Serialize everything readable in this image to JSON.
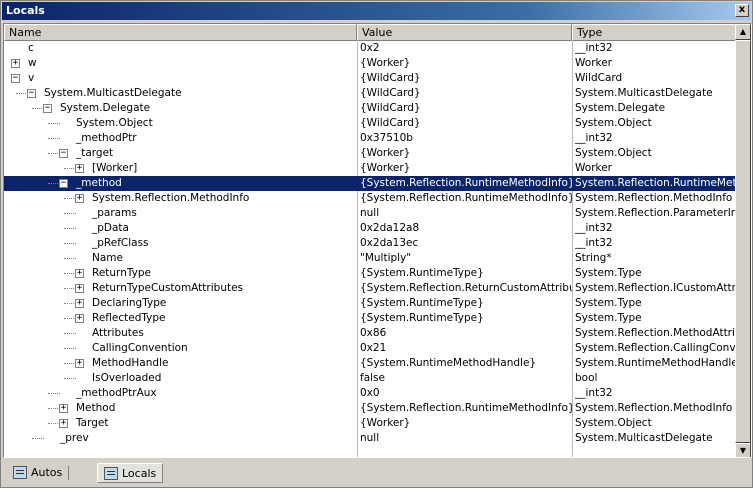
{
  "window": {
    "title": "Locals",
    "close_glyph": "x"
  },
  "columns": {
    "name": "Name",
    "value": "Value",
    "type": "Type"
  },
  "rows": [
    {
      "depth": 0,
      "toggle": "",
      "name": "c",
      "value": "0x2",
      "type": "__int32"
    },
    {
      "depth": 0,
      "toggle": "+",
      "name": "w",
      "value": "{Worker}",
      "type": "Worker"
    },
    {
      "depth": 0,
      "toggle": "-",
      "name": "v",
      "value": "{WildCard}",
      "type": "WildCard"
    },
    {
      "depth": 1,
      "toggle": "-",
      "name": "System.MulticastDelegate",
      "value": "{WildCard}",
      "type": "System.MulticastDelegate"
    },
    {
      "depth": 2,
      "toggle": "-",
      "name": "System.Delegate",
      "value": "{WildCard}",
      "type": "System.Delegate"
    },
    {
      "depth": 3,
      "toggle": "",
      "name": "System.Object",
      "value": "{WildCard}",
      "type": "System.Object"
    },
    {
      "depth": 3,
      "toggle": "",
      "name": "_methodPtr",
      "value": "0x37510b",
      "type": "__int32"
    },
    {
      "depth": 3,
      "toggle": "-",
      "name": "_target",
      "value": "{Worker}",
      "type": "System.Object"
    },
    {
      "depth": 4,
      "toggle": "+",
      "name": "[Worker]",
      "value": "{Worker}",
      "type": "Worker"
    },
    {
      "depth": 3,
      "toggle": "-",
      "name": "_method",
      "value": "{System.Reflection.RuntimeMethodInfo}",
      "type": "System.Reflection.RuntimeMetho",
      "selected": true
    },
    {
      "depth": 4,
      "toggle": "+",
      "name": "System.Reflection.MethodInfo",
      "value": "{System.Reflection.RuntimeMethodInfo}",
      "type": "System.Reflection.MethodInfo"
    },
    {
      "depth": 4,
      "toggle": "",
      "name": "_params",
      "value": "null",
      "type": "System.Reflection.ParameterInfo"
    },
    {
      "depth": 4,
      "toggle": "",
      "name": "_pData",
      "value": "0x2da12a8",
      "type": "__int32"
    },
    {
      "depth": 4,
      "toggle": "",
      "name": "_pRefClass",
      "value": "0x2da13ec",
      "type": "__int32"
    },
    {
      "depth": 4,
      "toggle": "",
      "name": "Name",
      "value": "\"Multiply\"",
      "type": "String*"
    },
    {
      "depth": 4,
      "toggle": "+",
      "name": "ReturnType",
      "value": "{System.RuntimeType}",
      "type": "System.Type"
    },
    {
      "depth": 4,
      "toggle": "+",
      "name": "ReturnTypeCustomAttributes",
      "value": "{System.Reflection.ReturnCustomAttributes",
      "type": "System.Reflection.ICustomAttrib"
    },
    {
      "depth": 4,
      "toggle": "+",
      "name": "DeclaringType",
      "value": "{System.RuntimeType}",
      "type": "System.Type"
    },
    {
      "depth": 4,
      "toggle": "+",
      "name": "ReflectedType",
      "value": "{System.RuntimeType}",
      "type": "System.Type"
    },
    {
      "depth": 4,
      "toggle": "",
      "name": "Attributes",
      "value": "0x86",
      "type": "System.Reflection.MethodAttribu"
    },
    {
      "depth": 4,
      "toggle": "",
      "name": "CallingConvention",
      "value": "0x21",
      "type": "System.Reflection.CallingConven"
    },
    {
      "depth": 4,
      "toggle": "+",
      "name": "MethodHandle",
      "value": "{System.RuntimeMethodHandle}",
      "type": "System.RuntimeMethodHandle"
    },
    {
      "depth": 4,
      "toggle": "",
      "name": "IsOverloaded",
      "value": "false",
      "type": "bool"
    },
    {
      "depth": 3,
      "toggle": "",
      "name": "_methodPtrAux",
      "value": "0x0",
      "type": "__int32"
    },
    {
      "depth": 3,
      "toggle": "+",
      "name": "Method",
      "value": "{System.Reflection.RuntimeMethodInfo}",
      "type": "System.Reflection.MethodInfo"
    },
    {
      "depth": 3,
      "toggle": "+",
      "name": "Target",
      "value": "{Worker}",
      "type": "System.Object"
    },
    {
      "depth": 2,
      "toggle": "",
      "name": "_prev",
      "value": "null",
      "type": "System.MulticastDelegate"
    }
  ],
  "scrollbar": {
    "up_glyph": "▲",
    "down_glyph": "▼"
  },
  "tabs": [
    {
      "label": "Autos",
      "icon": "autos-window-icon",
      "active": false
    },
    {
      "label": "Locals",
      "icon": "locals-window-icon",
      "active": true
    }
  ]
}
